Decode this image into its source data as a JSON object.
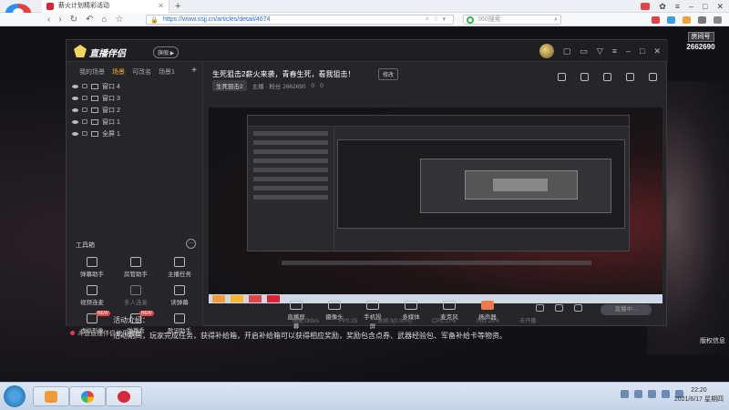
{
  "browser": {
    "tab_title": "薪火计划精彩活动",
    "url": "https://www.ssjj.cn/articles/detail/4674",
    "search_placeholder": "360搜索"
  },
  "room": {
    "label": "房间号",
    "number": "2662690"
  },
  "app": {
    "name": "直播伴侣",
    "version_badge": "旗舰",
    "scene_tabs": [
      "我的场景",
      "场景",
      "可改名",
      "场景1"
    ],
    "sources": [
      "窗口 4",
      "窗口 3",
      "窗口 2",
      "窗口 1",
      "全屏 1"
    ],
    "tools_title": "工具箱",
    "tools": [
      {
        "label": "弹幕助手",
        "dim": false,
        "badge": ""
      },
      {
        "label": "房管助手",
        "dim": false,
        "badge": ""
      },
      {
        "label": "主播任务",
        "dim": false,
        "badge": ""
      },
      {
        "label": "视频连麦",
        "dim": false,
        "badge": ""
      },
      {
        "label": "多人连麦",
        "dim": true,
        "badge": ""
      },
      {
        "label": "读弹幕",
        "dim": false,
        "badge": ""
      },
      {
        "label": "虚拟形象",
        "dim": false,
        "badge": "NEW"
      },
      {
        "label": "弹幕秀",
        "dim": false,
        "badge": "NEW"
      },
      {
        "label": "歌词助手",
        "dim": false,
        "badge": ""
      }
    ],
    "tutorial": "斗鱼直播伴侣使用教程",
    "live_title": "生死狙击2薪火来袭，青春生死，看我狙击！",
    "edit_label": "修改",
    "category": "生死狙击2",
    "meta_text": "主播 · 粉丝  2662690",
    "meta_count1": "0",
    "meta_count2": "0",
    "controls": [
      "直播屏幕",
      "摄像头",
      "手机投屏",
      "多媒体",
      "麦克风",
      "扬声器"
    ],
    "live_button": "直播中...",
    "status": [
      "网速:0Kb/s",
      "FPS:25",
      "丢帧:0(0.00%)",
      "CPU:17%",
      "内存:29%",
      "未开播"
    ]
  },
  "activity": {
    "heading": "活动介绍：",
    "description": "活动期间，玩家完成任务，获得补给箱，开启补给箱可以获得相应奖励，奖励包含点券、武器经验包、军备补给卡等物资。"
  },
  "side_text": "版权信息",
  "taskbar": {
    "time": "22:20",
    "date": "2021/6/17 星期四"
  }
}
